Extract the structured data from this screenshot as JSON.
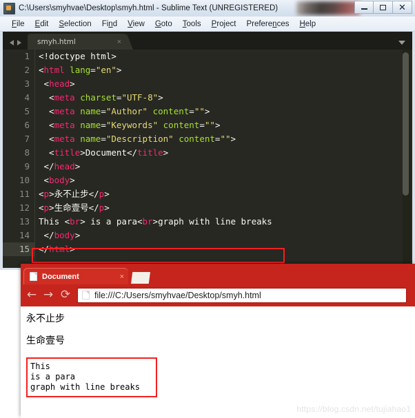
{
  "editor": {
    "window_title": "C:\\Users\\smyhvae\\Desktop\\smyh.html - Sublime Text (UNREGISTERED)",
    "app_icon": "sublime-text-icon",
    "window_controls": {
      "minimize": "minimize-icon",
      "maximize": "maximize-icon",
      "close": "close-icon"
    },
    "menu": [
      {
        "pre": "",
        "accel": "F",
        "post": "ile"
      },
      {
        "pre": "",
        "accel": "E",
        "post": "dit"
      },
      {
        "pre": "",
        "accel": "S",
        "post": "election"
      },
      {
        "pre": "Fi",
        "accel": "n",
        "post": "d"
      },
      {
        "pre": "",
        "accel": "V",
        "post": "iew"
      },
      {
        "pre": "",
        "accel": "G",
        "post": "oto"
      },
      {
        "pre": "",
        "accel": "T",
        "post": "ools"
      },
      {
        "pre": "",
        "accel": "P",
        "post": "roject"
      },
      {
        "pre": "Prefere",
        "accel": "n",
        "post": "ces"
      },
      {
        "pre": "",
        "accel": "H",
        "post": "elp"
      }
    ],
    "tab": {
      "label": "smyh.html",
      "close_glyph": "×",
      "nav_prev": "prev-tab-arrow",
      "nav_next": "next-tab-arrow",
      "overflow_menu": "tab-list-arrow"
    },
    "lines": [
      {
        "n": "1",
        "active": false,
        "tokens": [
          {
            "t": "<!doctype html>",
            "c": "tk-doct"
          }
        ]
      },
      {
        "n": "2",
        "active": false,
        "tokens": [
          {
            "t": "<",
            "c": "tk-punc"
          },
          {
            "t": "html",
            "c": "tk-tag"
          },
          {
            "t": " lang",
            "c": "tk-attr"
          },
          {
            "t": "=",
            "c": "tk-punc"
          },
          {
            "t": "\"en\"",
            "c": "tk-str"
          },
          {
            "t": ">",
            "c": "tk-punc"
          }
        ]
      },
      {
        "n": "3",
        "active": false,
        "tokens": [
          {
            "t": " <",
            "c": "tk-punc"
          },
          {
            "t": "head",
            "c": "tk-tag"
          },
          {
            "t": ">",
            "c": "tk-punc"
          }
        ]
      },
      {
        "n": "4",
        "active": false,
        "tokens": [
          {
            "t": "  <",
            "c": "tk-punc"
          },
          {
            "t": "meta",
            "c": "tk-tag"
          },
          {
            "t": " charset",
            "c": "tk-attr"
          },
          {
            "t": "=",
            "c": "tk-punc"
          },
          {
            "t": "\"UTF-8\"",
            "c": "tk-str"
          },
          {
            "t": ">",
            "c": "tk-punc"
          }
        ]
      },
      {
        "n": "5",
        "active": false,
        "tokens": [
          {
            "t": "  <",
            "c": "tk-punc"
          },
          {
            "t": "meta",
            "c": "tk-tag"
          },
          {
            "t": " name",
            "c": "tk-attr"
          },
          {
            "t": "=",
            "c": "tk-punc"
          },
          {
            "t": "\"Author\"",
            "c": "tk-str"
          },
          {
            "t": " content",
            "c": "tk-attr"
          },
          {
            "t": "=",
            "c": "tk-punc"
          },
          {
            "t": "\"\"",
            "c": "tk-str"
          },
          {
            "t": ">",
            "c": "tk-punc"
          }
        ]
      },
      {
        "n": "6",
        "active": false,
        "tokens": [
          {
            "t": "  <",
            "c": "tk-punc"
          },
          {
            "t": "meta",
            "c": "tk-tag"
          },
          {
            "t": " name",
            "c": "tk-attr"
          },
          {
            "t": "=",
            "c": "tk-punc"
          },
          {
            "t": "\"Keywords\"",
            "c": "tk-str"
          },
          {
            "t": " content",
            "c": "tk-attr"
          },
          {
            "t": "=",
            "c": "tk-punc"
          },
          {
            "t": "\"\"",
            "c": "tk-str"
          },
          {
            "t": ">",
            "c": "tk-punc"
          }
        ]
      },
      {
        "n": "7",
        "active": false,
        "tokens": [
          {
            "t": "  <",
            "c": "tk-punc"
          },
          {
            "t": "meta",
            "c": "tk-tag"
          },
          {
            "t": " name",
            "c": "tk-attr"
          },
          {
            "t": "=",
            "c": "tk-punc"
          },
          {
            "t": "\"Description\"",
            "c": "tk-str"
          },
          {
            "t": " content",
            "c": "tk-attr"
          },
          {
            "t": "=",
            "c": "tk-punc"
          },
          {
            "t": "\"\"",
            "c": "tk-str"
          },
          {
            "t": ">",
            "c": "tk-punc"
          }
        ]
      },
      {
        "n": "8",
        "active": false,
        "tokens": [
          {
            "t": "  <",
            "c": "tk-punc"
          },
          {
            "t": "title",
            "c": "tk-tag"
          },
          {
            "t": ">",
            "c": "tk-punc"
          },
          {
            "t": "Document",
            "c": "tk-text"
          },
          {
            "t": "</",
            "c": "tk-punc"
          },
          {
            "t": "title",
            "c": "tk-tag"
          },
          {
            "t": ">",
            "c": "tk-punc"
          }
        ]
      },
      {
        "n": "9",
        "active": false,
        "tokens": [
          {
            "t": " </",
            "c": "tk-punc"
          },
          {
            "t": "head",
            "c": "tk-tag"
          },
          {
            "t": ">",
            "c": "tk-punc"
          }
        ]
      },
      {
        "n": "10",
        "active": false,
        "tokens": [
          {
            "t": " <",
            "c": "tk-punc"
          },
          {
            "t": "body",
            "c": "tk-tag"
          },
          {
            "t": ">",
            "c": "tk-punc"
          }
        ]
      },
      {
        "n": "11",
        "active": false,
        "tokens": [
          {
            "t": "<",
            "c": "tk-punc"
          },
          {
            "t": "p",
            "c": "tk-tag"
          },
          {
            "t": ">",
            "c": "tk-punc"
          },
          {
            "t": "永不止步",
            "c": "tk-text"
          },
          {
            "t": "</",
            "c": "tk-punc"
          },
          {
            "t": "p",
            "c": "tk-tag"
          },
          {
            "t": ">",
            "c": "tk-punc"
          }
        ]
      },
      {
        "n": "12",
        "active": false,
        "tokens": [
          {
            "t": "<",
            "c": "tk-punc"
          },
          {
            "t": "p",
            "c": "tk-tag"
          },
          {
            "t": ">",
            "c": "tk-punc"
          },
          {
            "t": "生命壹号",
            "c": "tk-text"
          },
          {
            "t": "</",
            "c": "tk-punc"
          },
          {
            "t": "p",
            "c": "tk-tag"
          },
          {
            "t": ">",
            "c": "tk-punc"
          }
        ]
      },
      {
        "n": "13",
        "active": false,
        "tokens": [
          {
            "t": "This <",
            "c": "tk-text"
          },
          {
            "t": "br",
            "c": "tk-tag"
          },
          {
            "t": "> is a para<",
            "c": "tk-text"
          },
          {
            "t": "br",
            "c": "tk-tag"
          },
          {
            "t": ">graph with line breaks",
            "c": "tk-text"
          }
        ]
      },
      {
        "n": "14",
        "active": false,
        "tokens": [
          {
            "t": " </",
            "c": "tk-punc"
          },
          {
            "t": "body",
            "c": "tk-tag"
          },
          {
            "t": ">",
            "c": "tk-punc"
          }
        ]
      },
      {
        "n": "15",
        "active": true,
        "tokens": [
          {
            "t": "</",
            "c": "tk-punc"
          },
          {
            "t": "html",
            "c": "tk-tag"
          },
          {
            "t": ">",
            "c": "tk-punc"
          }
        ]
      }
    ],
    "colors": {
      "background": "#272822",
      "tag": "#f92672",
      "attribute": "#a6e22e",
      "string": "#e6db74",
      "text": "#f8f8f2",
      "gutter_text": "#8a8b83",
      "highlight_box": "#f42020"
    }
  },
  "browser": {
    "tab": {
      "title": "Document",
      "favicon": "page-icon",
      "close_glyph": "×"
    },
    "new_tab_button": "new-tab-icon",
    "nav": {
      "back": "←",
      "forward": "→",
      "reload": "⟳"
    },
    "omnibox": {
      "url": "file:///C:/Users/smyhvae/Desktop/smyh.html",
      "page_icon": "page-icon"
    },
    "page": {
      "paragraphs": [
        "永不止步",
        "生命壹号"
      ],
      "boxed_lines": [
        "This",
        "is a para",
        "graph with line breaks"
      ]
    },
    "theme_color": "#c5251c"
  },
  "watermark": "https://blog.csdn.net/tujiahao1"
}
